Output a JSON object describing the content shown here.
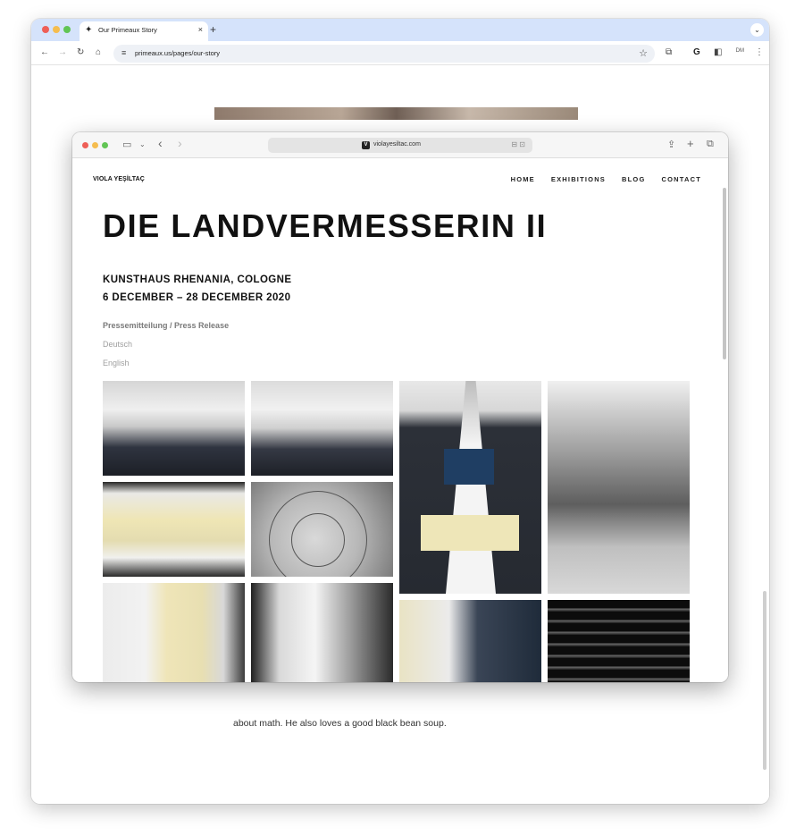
{
  "outer_browser": {
    "tab": {
      "title": "Our Primeaux Story",
      "close": "×"
    },
    "new_tab": "+",
    "tab_dropdown": "⌄",
    "nav": {
      "back": "←",
      "forward": "→",
      "reload": "↻",
      "home": "⌂"
    },
    "address": {
      "url": "primeaux.us/pages/our-story",
      "tune": "≡",
      "star": "☆"
    },
    "right_icons": {
      "extensions": "⧉",
      "google": "G",
      "sidebar": "◧",
      "profile": "DM",
      "menu": "⋮"
    },
    "page": {
      "about_text": "about math. He also loves a good black bean soup."
    }
  },
  "safari": {
    "icons": {
      "sidebar": "▭",
      "chevron": "⌄",
      "back": "‹",
      "forward": "›",
      "share": "⇪",
      "new_tab": "+",
      "tabs": "⧉"
    },
    "address": {
      "favicon": "V",
      "url": "violayesiltac.com",
      "lock": "🔒",
      "reader": "⊟ ⊡"
    },
    "site": {
      "logo": "VIOLA YEŞİLTAÇ",
      "nav": [
        "HOME",
        "EXHIBITIONS",
        "BLOG",
        "CONTACT"
      ],
      "title": "DIE LANDVERMESSERIN II",
      "venue": "KUNSTHAUS RHENANIA, COLOGNE",
      "dates": "6 DECEMBER – 28 DECEMBER 2020",
      "links": {
        "press": "Pressemitteilung / Press Release",
        "deutsch": "Deutsch",
        "english": "English"
      }
    }
  },
  "colors": {
    "outer_tabstrip": "#d5e3fb",
    "traffic_red": "#ee5f57",
    "traffic_yellow": "#f5bd4f",
    "traffic_green": "#61c554"
  }
}
